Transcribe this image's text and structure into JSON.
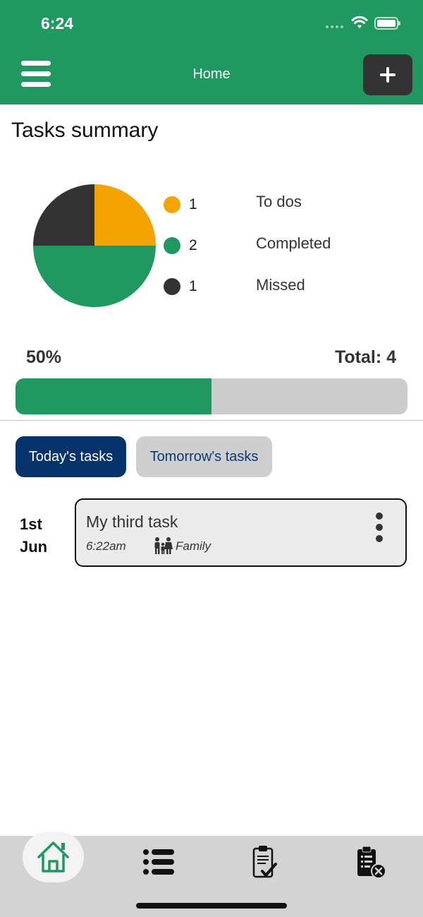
{
  "status_bar": {
    "time": "6:24"
  },
  "header": {
    "title": "Home",
    "menu_icon": "hamburger-menu-icon",
    "add_icon": "plus-icon"
  },
  "summary": {
    "title": "Tasks summary",
    "legend": [
      {
        "count": "1",
        "label": "To dos",
        "color": "#f4a300"
      },
      {
        "count": "2",
        "label": "Completed",
        "color": "#1f9960"
      },
      {
        "count": "1",
        "label": "Missed",
        "color": "#333333"
      }
    ],
    "percent": "50%",
    "total": "Total: 4",
    "progress_fraction": 0.5
  },
  "chart_data": {
    "type": "pie",
    "slices": [
      {
        "label": "To dos",
        "value": 1,
        "color": "#f4a300"
      },
      {
        "label": "Completed",
        "value": 2,
        "color": "#1f9960"
      },
      {
        "label": "Missed",
        "value": 1,
        "color": "#333333"
      }
    ]
  },
  "tabs": [
    {
      "label": "Today's tasks",
      "active": true
    },
    {
      "label": "Tomorrow's tasks",
      "active": false
    }
  ],
  "tasks": [
    {
      "date_day": "1st",
      "date_month": "Jun",
      "title": "My third task",
      "time": "6:22am",
      "category": "Family",
      "category_icon": "family-icon"
    }
  ],
  "bottom_nav": [
    {
      "icon": "home-icon",
      "active": true
    },
    {
      "icon": "list-icon",
      "active": false
    },
    {
      "icon": "clipboard-check-icon",
      "active": false
    },
    {
      "icon": "clipboard-cancel-icon",
      "active": false
    }
  ],
  "colors": {
    "brand": "#1f9960",
    "dark": "#333333",
    "accent": "#f4a300",
    "tab_active": "#05336b"
  }
}
